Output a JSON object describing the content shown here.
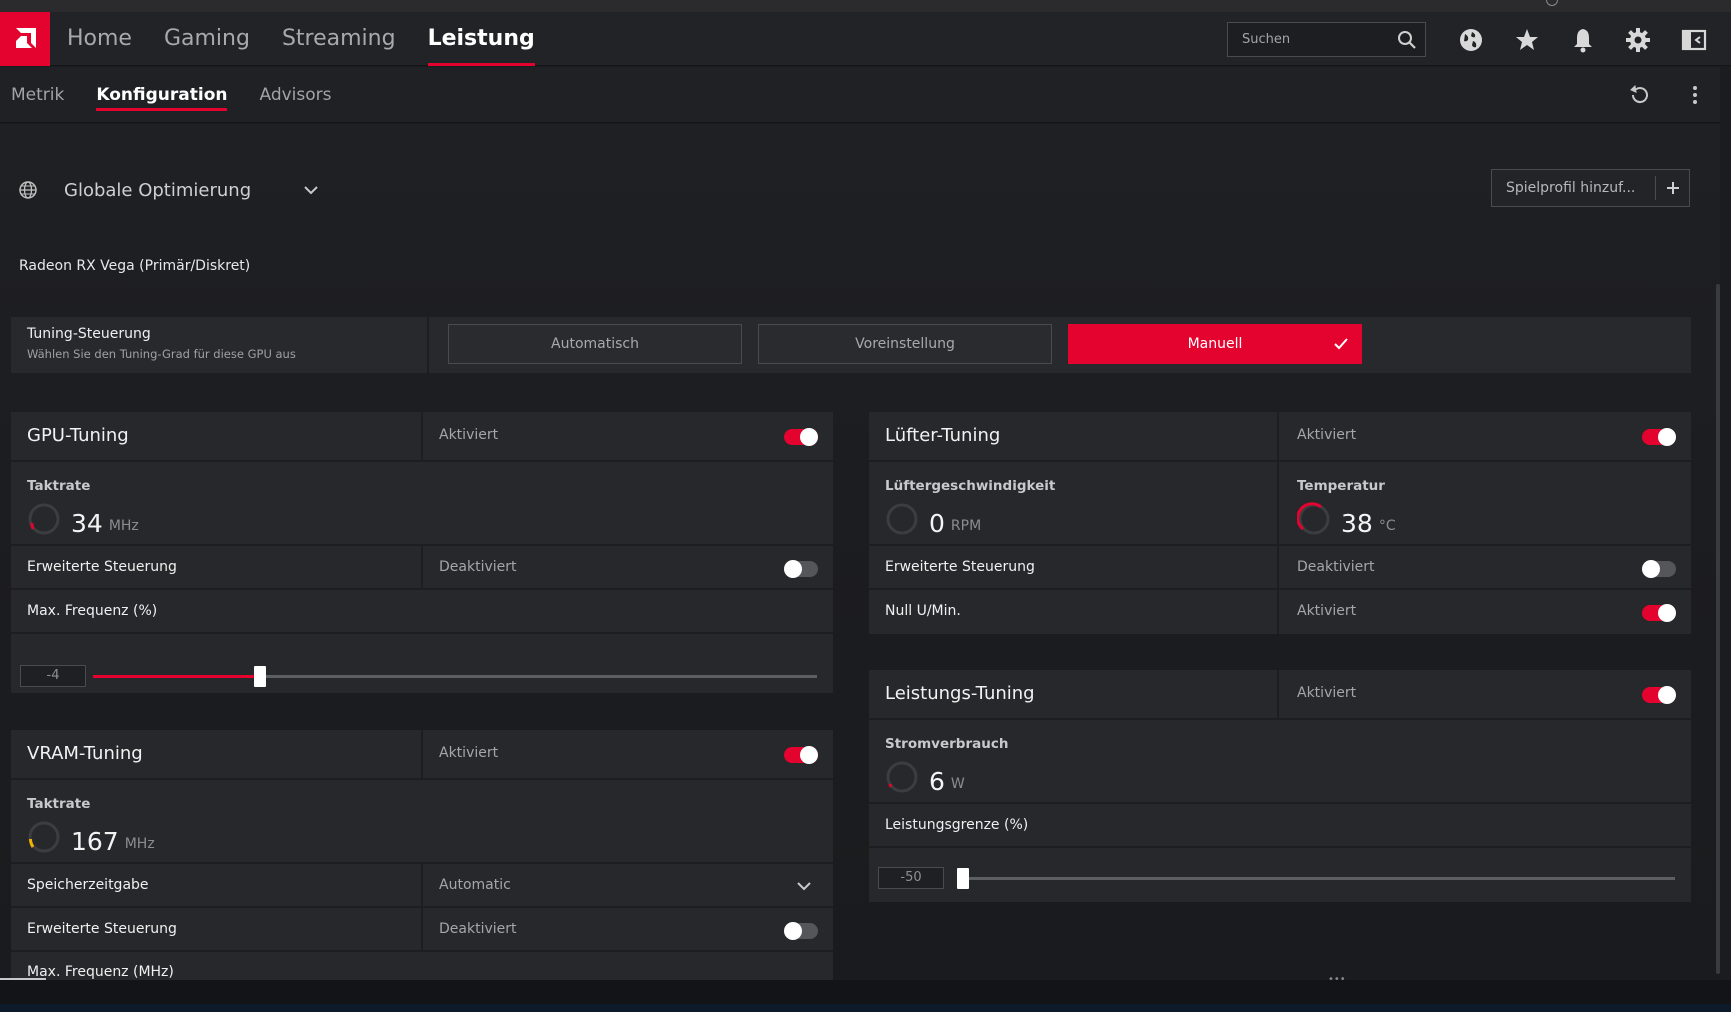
{
  "header": {
    "nav": [
      {
        "label": "Home"
      },
      {
        "label": "Gaming"
      },
      {
        "label": "Streaming"
      },
      {
        "label": "Leistung"
      }
    ],
    "active_nav": "Leistung",
    "search_placeholder": "Suchen",
    "icons": [
      "globe-icon",
      "star-icon",
      "bell-icon",
      "gear-icon",
      "window-icon"
    ]
  },
  "subnav": {
    "tabs": [
      {
        "label": "Metrik"
      },
      {
        "label": "Konfiguration"
      },
      {
        "label": "Advisors"
      }
    ],
    "active_tab": "Konfiguration",
    "icons": [
      "reset-icon",
      "more-icon"
    ]
  },
  "profile": {
    "label": "Globale Optimierung",
    "add_button": "Spielprofil hinzuf..."
  },
  "gpu_name": "Radeon RX Vega (Primär/Diskret)",
  "tuning_control": {
    "title": "Tuning-Steuerung",
    "subtitle": "Wählen Sie den Tuning-Grad für diese GPU aus",
    "options": [
      "Automatisch",
      "Voreinstellung",
      "Manuell"
    ],
    "selected": "Manuell"
  },
  "gpu_tuning": {
    "title": "GPU-Tuning",
    "state": "Aktiviert",
    "enabled": true,
    "clock_label": "Taktrate",
    "clock_value": "34",
    "clock_unit": "MHz",
    "advanced_label": "Erweiterte Steuerung",
    "advanced_state": "Deaktiviert",
    "advanced_enabled": false,
    "maxfreq_label": "Max. Frequenz (%)",
    "maxfreq_value": "-4",
    "maxfreq_fraction": 0.23
  },
  "vram_tuning": {
    "title": "VRAM-Tuning",
    "state": "Aktiviert",
    "enabled": true,
    "clock_label": "Taktrate",
    "clock_value": "167",
    "clock_unit": "MHz",
    "timing_label": "Speicherzeitgabe",
    "timing_value": "Automatic",
    "advanced_label": "Erweiterte Steuerung",
    "advanced_state": "Deaktiviert",
    "advanced_enabled": false,
    "maxfreq_label": "Max. Frequenz (MHz)"
  },
  "fan_tuning": {
    "title": "Lüfter-Tuning",
    "state": "Aktiviert",
    "enabled": true,
    "speed_label": "Lüftergeschwindigkeit",
    "speed_value": "0",
    "speed_unit": "RPM",
    "temp_label": "Temperatur",
    "temp_value": "38",
    "temp_unit": "°C",
    "advanced_label": "Erweiterte Steuerung",
    "advanced_state": "Deaktiviert",
    "advanced_enabled": false,
    "zero_rpm_label": "Null U/Min.",
    "zero_rpm_state": "Aktiviert",
    "zero_rpm_enabled": true
  },
  "power_tuning": {
    "title": "Leistungs-Tuning",
    "state": "Aktiviert",
    "enabled": true,
    "power_label": "Stromverbrauch",
    "power_value": "6",
    "power_unit": "W",
    "limit_label": "Leistungsgrenze (%)",
    "limit_value": "-50",
    "limit_fraction": 0.0
  },
  "colors": {
    "accent": "#e4032e",
    "background": "#1b1c1f",
    "panel": "#27282b"
  }
}
